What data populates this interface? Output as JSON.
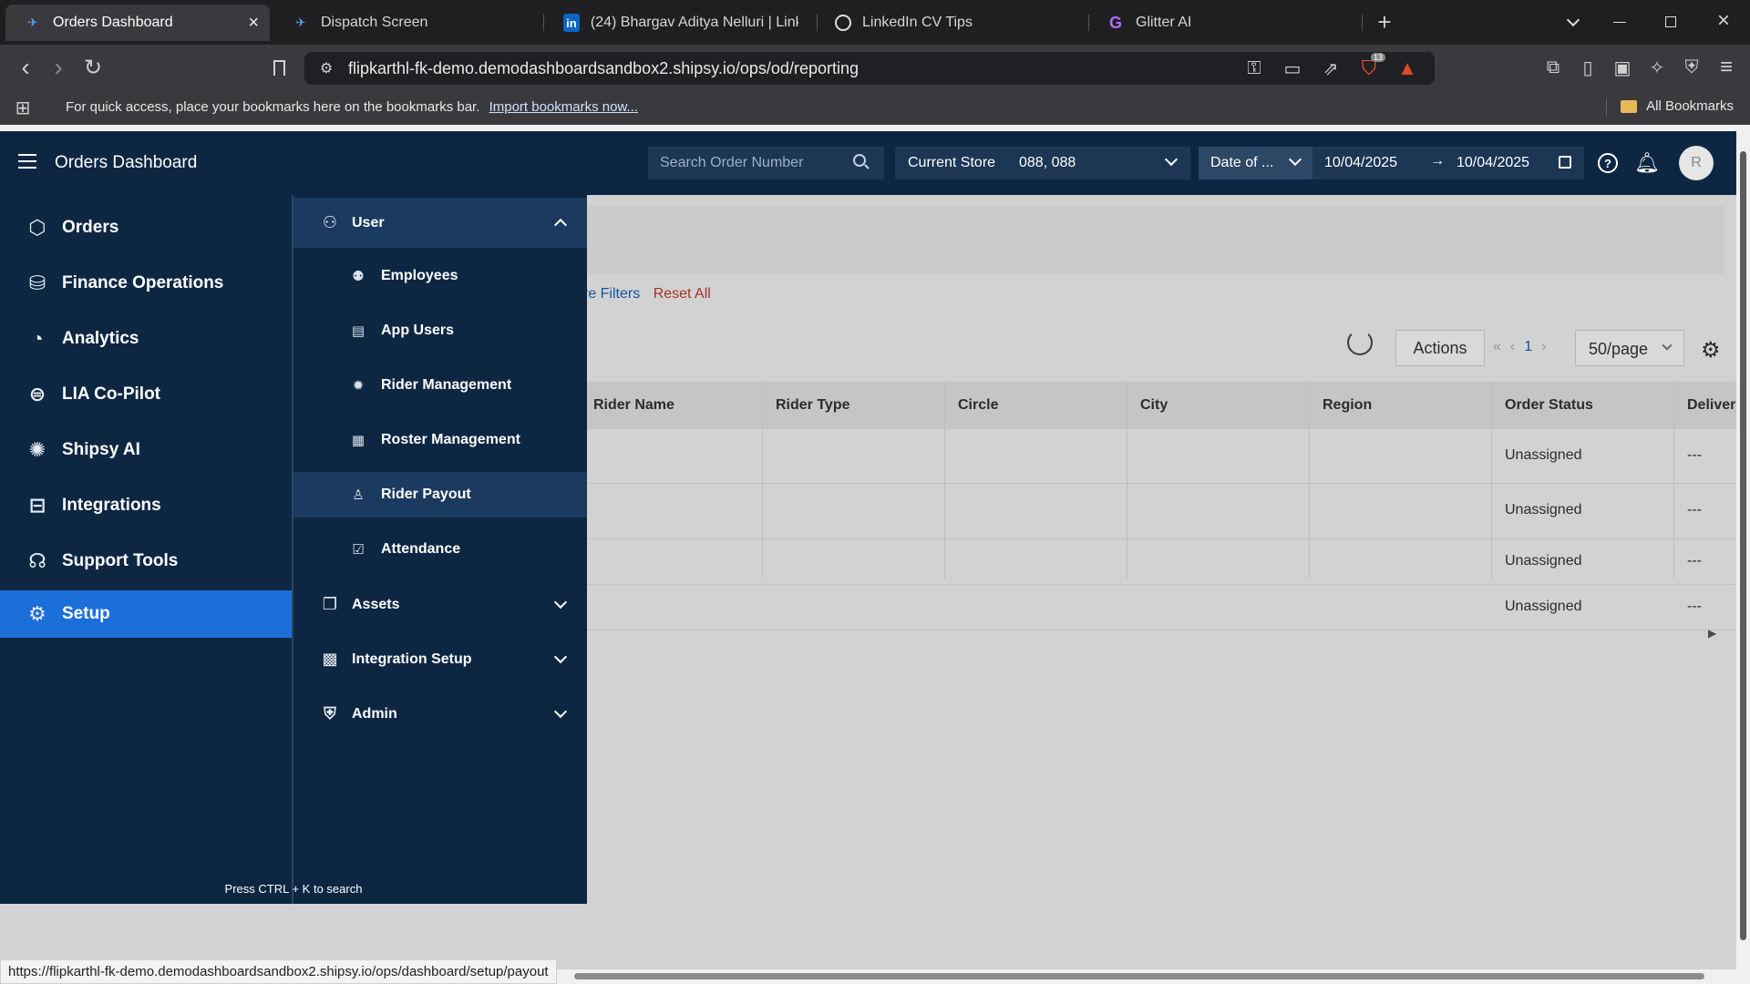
{
  "browser": {
    "tabs": [
      {
        "title": "Orders Dashboard",
        "active": true
      },
      {
        "title": "Dispatch Screen",
        "active": false
      },
      {
        "title": "(24) Bhargav Aditya Nelluri | LinkedI",
        "active": false
      },
      {
        "title": "LinkedIn CV Tips",
        "active": false
      },
      {
        "title": "Glitter AI",
        "active": false
      }
    ],
    "url": "flipkarthl-fk-demo.demodashboardsandbox2.shipsy.io/ops/od/reporting",
    "shields_count": "13",
    "bookmarks_bar": {
      "message": "For quick access, place your bookmarks here on the bookmarks bar.",
      "import_link": "Import bookmarks now...",
      "all_bookmarks": "All Bookmarks"
    }
  },
  "header": {
    "title": "Orders Dashboard",
    "search_placeholder": "Search Order Number",
    "store_label": "Current Store",
    "store_value": "088, 088",
    "date_type": "Date of ...",
    "date_from": "10/04/2025",
    "date_to": "10/04/2025",
    "avatar_letter": "R"
  },
  "sidebar": {
    "items": [
      {
        "label": "Orders",
        "icon": "box-icon"
      },
      {
        "label": "Finance Operations",
        "icon": "coins-icon"
      },
      {
        "label": "Analytics",
        "icon": "pie-chart-icon"
      },
      {
        "label": "LIA Co-Pilot",
        "icon": "copilot-icon"
      },
      {
        "label": "Shipsy AI",
        "icon": "brain-icon"
      },
      {
        "label": "Integrations",
        "icon": "integrations-icon"
      },
      {
        "label": "Support Tools",
        "icon": "headset-icon"
      },
      {
        "label": "Setup",
        "icon": "gear-icon",
        "active": true
      }
    ],
    "hint": "Press CTRL + K to search"
  },
  "submenu": {
    "user": {
      "label": "User",
      "expanded": true
    },
    "user_items": [
      {
        "label": "Employees",
        "icon": "employees-icon"
      },
      {
        "label": "App Users",
        "icon": "app-users-icon"
      },
      {
        "label": "Rider Management",
        "icon": "rider-management-icon"
      },
      {
        "label": "Roster Management",
        "icon": "roster-icon"
      },
      {
        "label": "Rider Payout",
        "icon": "rider-payout-icon",
        "active": true
      },
      {
        "label": "Attendance",
        "icon": "attendance-icon"
      }
    ],
    "groups": [
      {
        "label": "Assets",
        "icon": "assets-icon"
      },
      {
        "label": "Integration Setup",
        "icon": "integration-setup-icon"
      },
      {
        "label": "Admin",
        "icon": "admin-shield-icon"
      }
    ]
  },
  "page": {
    "filters_link": "re Filters",
    "reset_link": "Reset All",
    "actions_label": "Actions",
    "page_number": "1",
    "per_page": "50/page",
    "table": {
      "columns": [
        "Rider Name",
        "Rider Type",
        "Circle",
        "City",
        "Region",
        "Order Status",
        "Deliver"
      ],
      "rows": [
        {
          "order_status": "Unassigned",
          "deliver": "---"
        },
        {
          "order_status": "Unassigned",
          "deliver": "---"
        },
        {
          "order_status": "Unassigned",
          "deliver": "---"
        },
        {
          "order_status": "Unassigned",
          "deliver": "---"
        }
      ]
    }
  },
  "statusbar": {
    "url": "https://flipkarthl-fk-demo.demodashboardsandbox2.shipsy.io/ops/dashboard/setup/payout"
  },
  "colors": {
    "nav_bg": "#0d2743",
    "active_blue": "#1c6fd9",
    "submenu_active": "#1b3a5f"
  }
}
